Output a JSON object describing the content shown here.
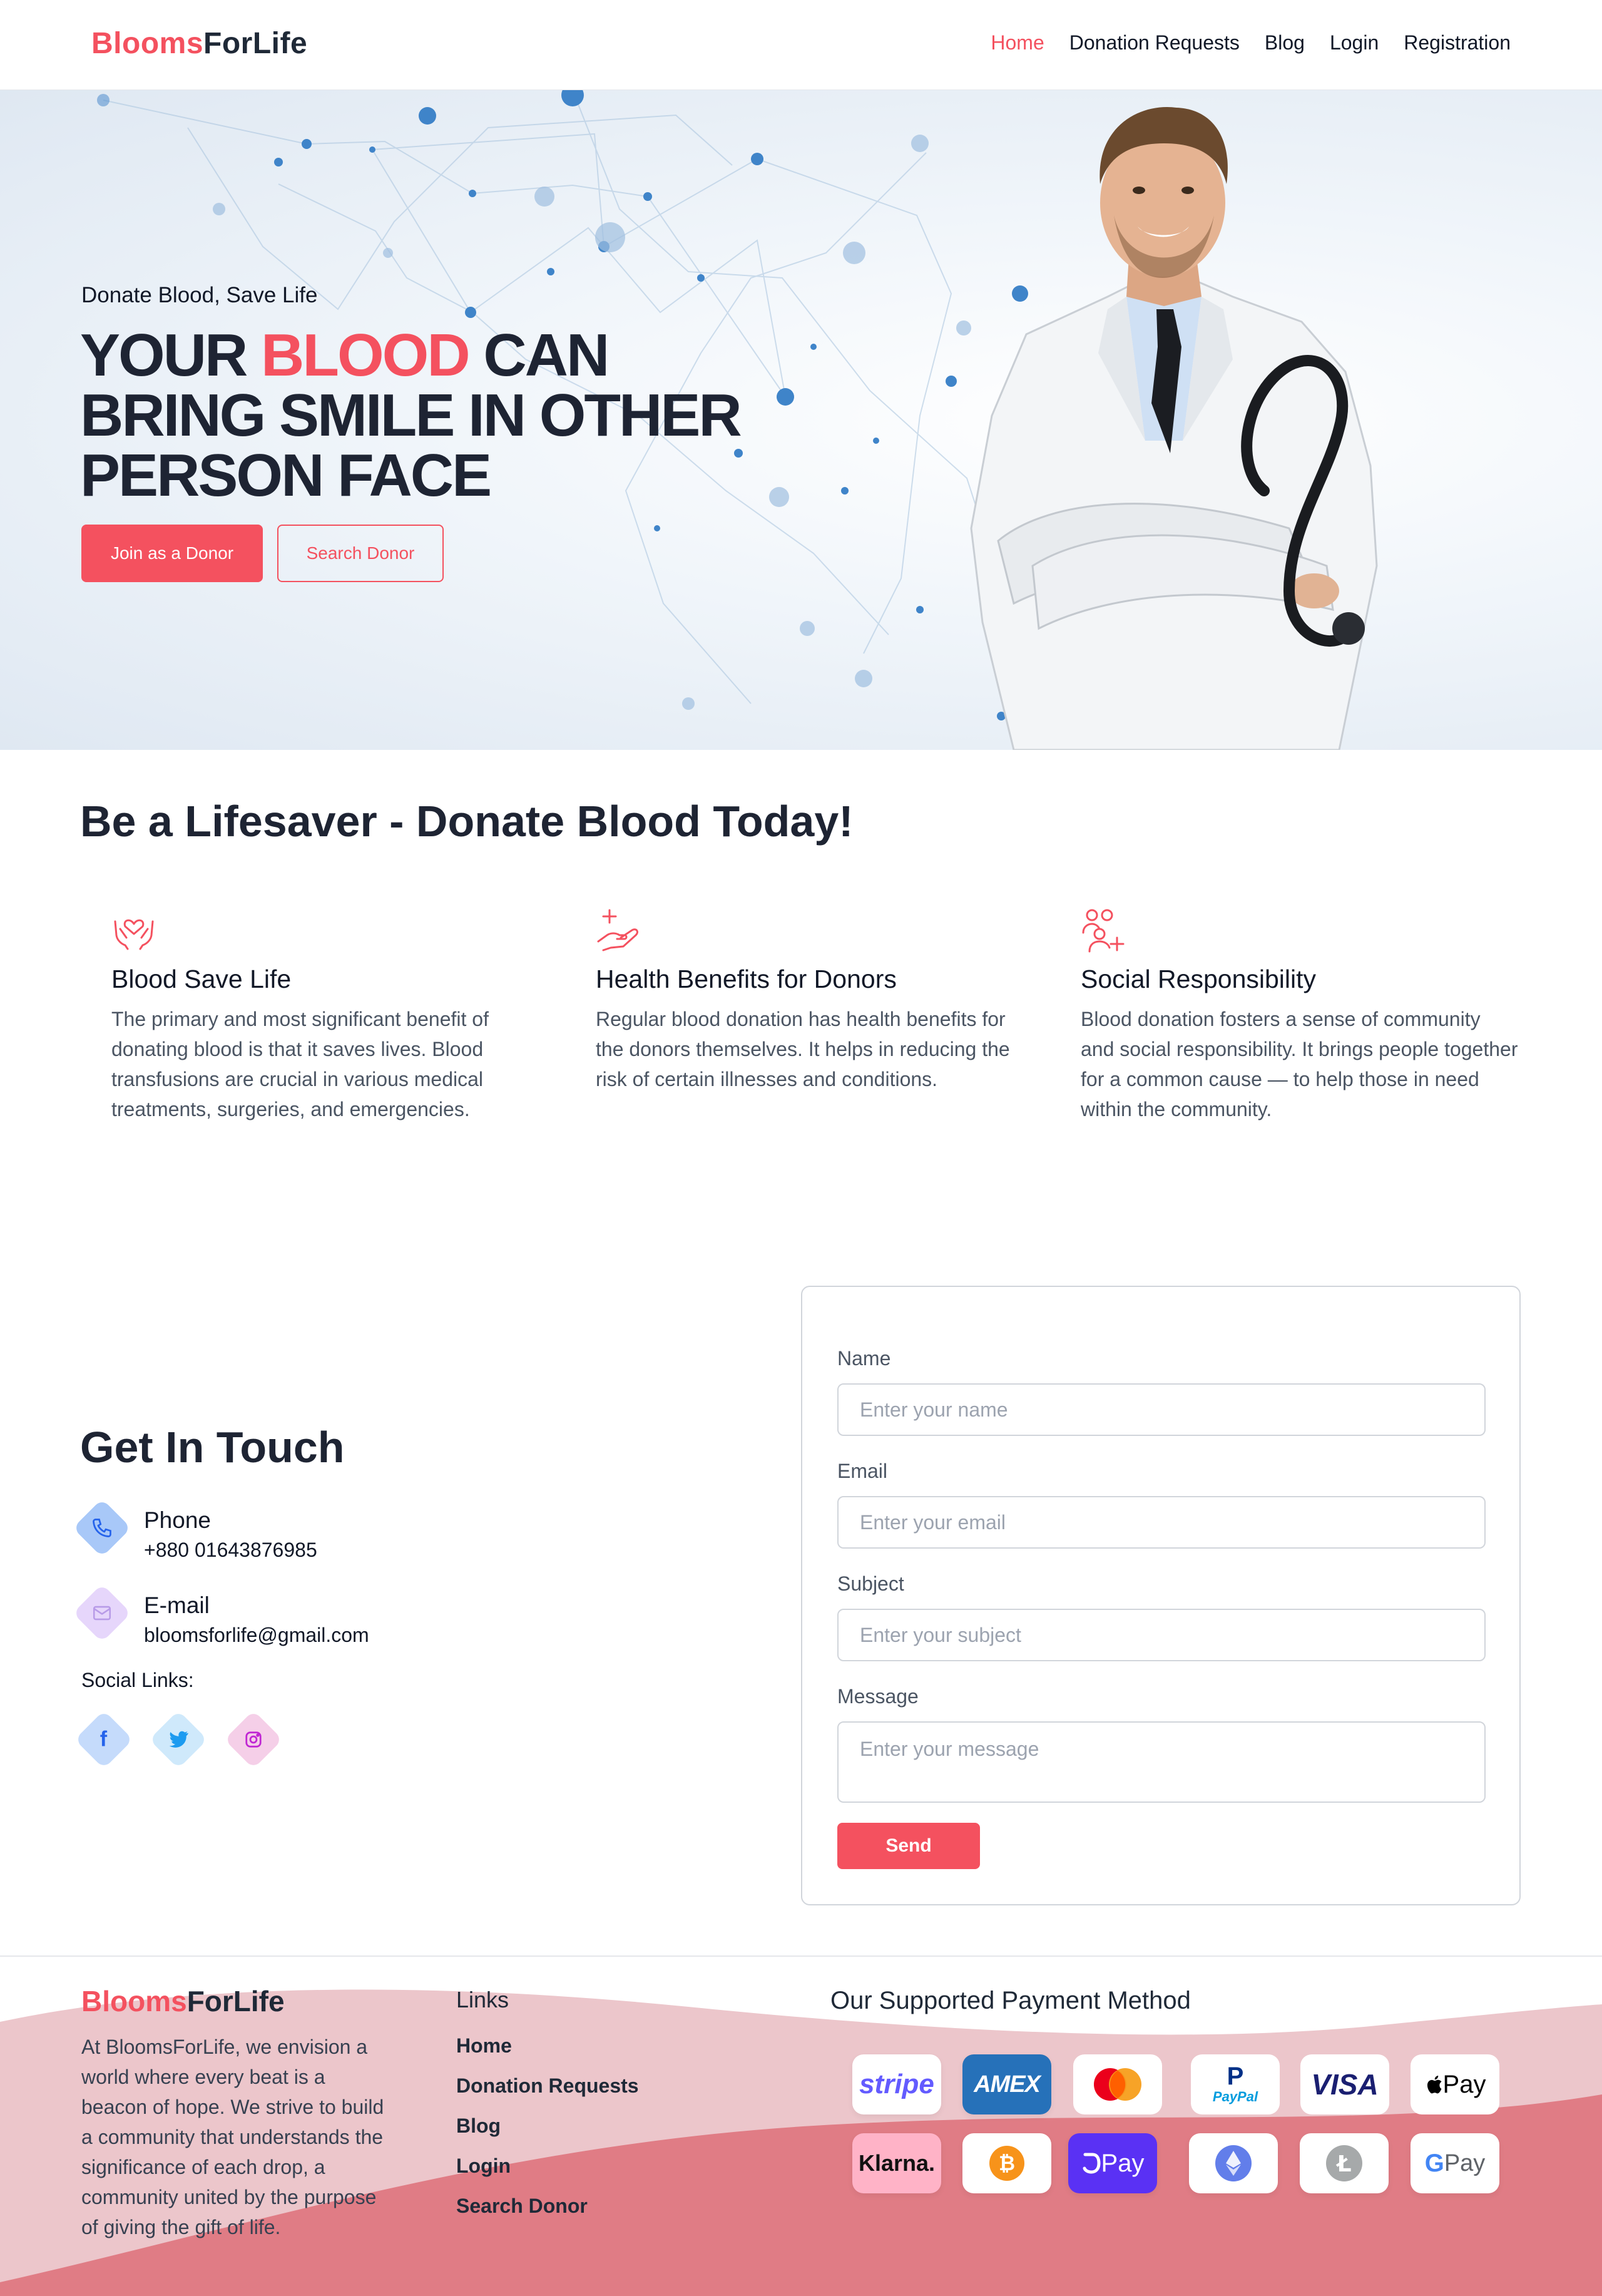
{
  "brand": {
    "part1": "Blooms",
    "part2": "ForLife"
  },
  "nav": {
    "items": [
      {
        "label": "Home",
        "active": true
      },
      {
        "label": "Donation Requests",
        "active": false
      },
      {
        "label": "Blog",
        "active": false
      },
      {
        "label": "Login",
        "active": false
      },
      {
        "label": "Registration",
        "active": false
      }
    ]
  },
  "hero": {
    "tagline": "Donate Blood, Save Life",
    "headline_pre": "YOUR ",
    "headline_highlight": "BLOOD",
    "headline_post": " CAN BRING SMILE IN OTHER PERSON FACE",
    "primary_button": "Join as a Donor",
    "secondary_button": "Search Donor"
  },
  "benefits": {
    "title": "Be a Lifesaver - Donate Blood Today!",
    "cards": [
      {
        "icon": "heart-hands-icon",
        "title": "Blood Save Life",
        "text": "The primary and most significant benefit of donating blood is that it saves lives. Blood transfusions are crucial in various medical treatments, surgeries, and emergencies."
      },
      {
        "icon": "hand-plus-icon",
        "title": "Health Benefits for Donors",
        "text": "Regular blood donation has health benefits for the donors themselves. It helps in reducing the risk of certain illnesses and conditions."
      },
      {
        "icon": "people-plus-icon",
        "title": "Social Responsibility",
        "text": "Blood donation fosters a sense of community and social responsibility. It brings people together for a common cause — to help those in need within the community."
      }
    ]
  },
  "contact": {
    "title": "Get In Touch",
    "phone_label": "Phone",
    "phone_value": "+880 01643876985",
    "email_label": "E-mail",
    "email_value": "bloomsforlife@gmail.com",
    "social_label": "Social Links:",
    "socials": [
      "facebook-icon",
      "twitter-icon",
      "instagram-icon"
    ]
  },
  "form": {
    "name_label": "Name",
    "name_placeholder": "Enter your name",
    "email_label": "Email",
    "email_placeholder": "Enter your email",
    "subject_label": "Subject",
    "subject_placeholder": "Enter your subject",
    "message_label": "Message",
    "message_placeholder": "Enter your message",
    "send_label": "Send"
  },
  "footer": {
    "about": "At BloomsForLife, we envision a world where every beat is a beacon of hope. We strive to build a community that understands the significance of each drop, a community united by the purpose of giving the gift of life.",
    "links_title": "Links",
    "links": [
      "Home",
      "Donation Requests",
      "Blog",
      "Login",
      "Search Donor"
    ],
    "payment_title": "Our Supported Payment Method",
    "payments_row1": [
      "stripe",
      "AMEX",
      "mastercard",
      "PayPal",
      "VISA",
      "Pay"
    ],
    "payments_row2": [
      "Klarna.",
      "bitcoin",
      "Pay",
      "ethereum",
      "litecoin",
      "Pay"
    ]
  },
  "colors": {
    "accent": "#f4515f",
    "dark": "#1e2433",
    "footer_wave_light": "#ecc6cb",
    "footer_wave_dark": "#e07c85"
  }
}
